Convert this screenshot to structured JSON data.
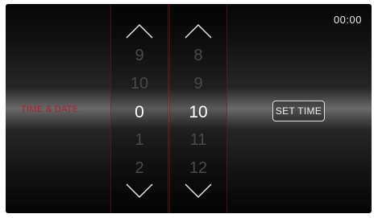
{
  "status": {
    "clock": "00:00"
  },
  "screen": {
    "title": "TIME & DATE"
  },
  "hour_picker": {
    "up_icon": "chevron-up-icon",
    "down_icon": "chevron-down-icon",
    "values": [
      "9",
      "10",
      "0",
      "1",
      "2"
    ],
    "selected": "0"
  },
  "minute_picker": {
    "up_icon": "chevron-up-icon",
    "down_icon": "chevron-down-icon",
    "values": [
      "8",
      "9",
      "10",
      "11",
      "12"
    ],
    "selected": "10"
  },
  "actions": {
    "set_time_label": "SET TIME"
  },
  "colors": {
    "accent": "#b31d33",
    "text": "#ffffff",
    "dim_text": "#4a4a4a",
    "background": "#050505"
  }
}
